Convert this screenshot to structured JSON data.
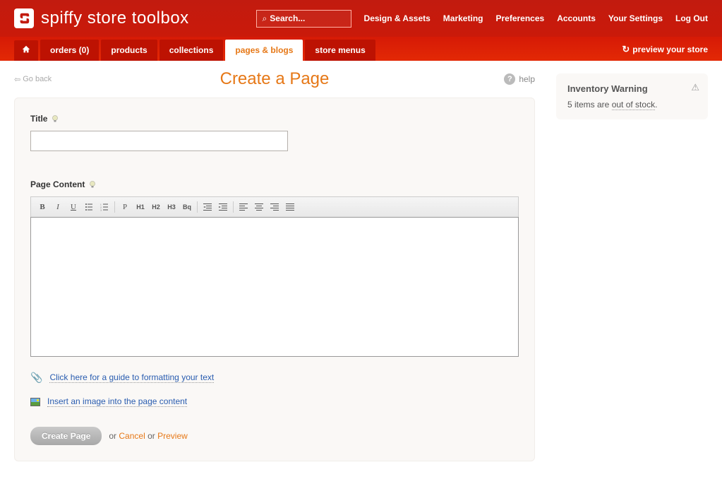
{
  "header": {
    "brand": "spiffy store toolbox",
    "search_placeholder": "Search...",
    "links": [
      "Design & Assets",
      "Marketing",
      "Preferences",
      "Accounts",
      "Your Settings",
      "Log Out"
    ]
  },
  "tabs": {
    "items": [
      "orders (0)",
      "products",
      "collections",
      "pages & blogs",
      "store menus"
    ],
    "active_index": 3,
    "preview_label": "preview your store"
  },
  "page": {
    "back_label": "Go back",
    "title": "Create a Page",
    "help_label": "help"
  },
  "form": {
    "title_label": "Title",
    "content_label": "Page Content",
    "toolbar": {
      "bold": "B",
      "italic": "I",
      "underline": "U",
      "ul": "list",
      "ol": "list",
      "p": "P",
      "h1": "H1",
      "h2": "H2",
      "h3": "H3",
      "bq": "Bq"
    },
    "guide_link": "Click here for a guide to formatting your text",
    "image_link": "Insert an image into the page content",
    "create_button": "Create Page",
    "or1": "or",
    "cancel": "Cancel",
    "or2": "or",
    "preview": "Preview"
  },
  "sidebar": {
    "warning_title": "Inventory Warning",
    "warning_prefix": "5 items are ",
    "warning_link": "out of stock",
    "warning_suffix": "."
  }
}
